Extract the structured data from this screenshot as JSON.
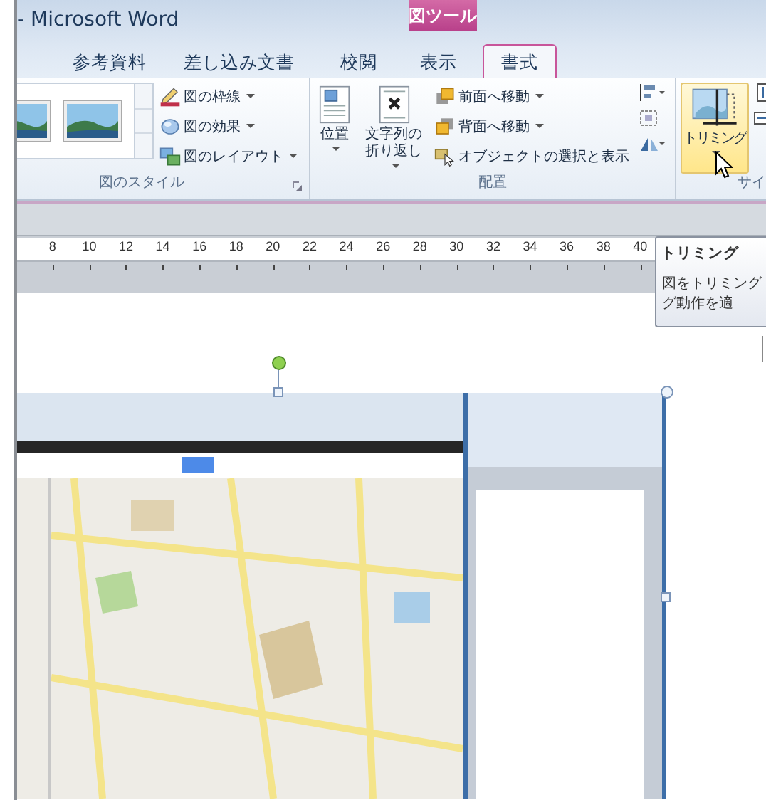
{
  "window": {
    "title": "- Microsoft Word",
    "context_tab": "図ツール"
  },
  "tabs": [
    {
      "label": "参考資料",
      "selected": false
    },
    {
      "label": "差し込み文書",
      "selected": false
    },
    {
      "label": "校閲",
      "selected": false
    },
    {
      "label": "表示",
      "selected": false
    },
    {
      "label": "書式",
      "selected": true
    }
  ],
  "ribbon": {
    "groups": [
      {
        "kind": "styles",
        "label": "図のスタイル",
        "commands": [
          {
            "label": "図の枠線",
            "dropdown": true
          },
          {
            "label": "図の効果",
            "dropdown": true
          },
          {
            "label": "図のレイアウト",
            "dropdown": true
          }
        ]
      },
      {
        "kind": "arrange",
        "label": "配置",
        "big_buttons": [
          {
            "label": "位置",
            "dropdown": true,
            "hovered": false
          },
          {
            "label": "文字列の折り返し",
            "dropdown": true,
            "hovered": false
          }
        ],
        "commands": [
          {
            "label": "前面へ移動",
            "dropdown": true
          },
          {
            "label": "背面へ移動",
            "dropdown": true
          },
          {
            "label": "オブジェクトの選択と表示",
            "dropdown": false
          }
        ]
      },
      {
        "kind": "size",
        "label": "サイ",
        "big_buttons": [
          {
            "label": "トリミング",
            "dropdown": true,
            "hovered": true
          }
        ]
      }
    ]
  },
  "ruler": {
    "ticks": [
      "8",
      "10",
      "12",
      "14",
      "16",
      "18",
      "20",
      "22",
      "24",
      "26",
      "28",
      "30",
      "32",
      "34",
      "36",
      "38",
      "40"
    ]
  },
  "tooltip": {
    "title": "トリミング",
    "lines": [
      "図をトリミング",
      "グ動作を適"
    ]
  },
  "document": {
    "image": {
      "kind": "picture",
      "selected": true
    }
  }
}
